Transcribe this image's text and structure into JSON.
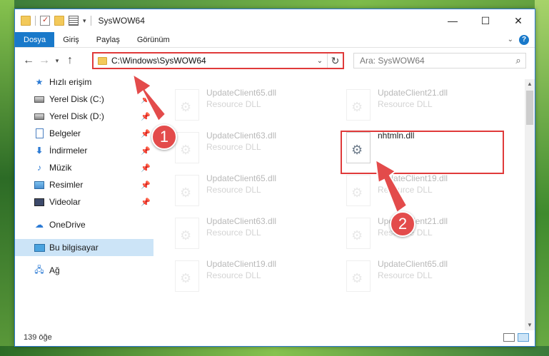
{
  "window": {
    "title": "SysWOW64"
  },
  "ribbon": {
    "tabs": [
      {
        "label": "Dosya",
        "active": true
      },
      {
        "label": "Giriş"
      },
      {
        "label": "Paylaş"
      },
      {
        "label": "Görünüm"
      }
    ]
  },
  "address": {
    "path": "C:\\Windows\\SysWOW64"
  },
  "search": {
    "placeholder": "Ara: SysWOW64"
  },
  "sidebar": {
    "items": [
      {
        "label": "Hızlı erişim",
        "icon": "star-icon"
      },
      {
        "label": "Yerel Disk (C:)",
        "icon": "disk-icon",
        "pinned": true
      },
      {
        "label": "Yerel Disk (D:)",
        "icon": "disk-icon",
        "pinned": true
      },
      {
        "label": "Belgeler",
        "icon": "documents-icon",
        "pinned": true
      },
      {
        "label": "İndirmeler",
        "icon": "downloads-icon",
        "pinned": true
      },
      {
        "label": "Müzik",
        "icon": "music-icon",
        "pinned": true
      },
      {
        "label": "Resimler",
        "icon": "pictures-icon",
        "pinned": true
      },
      {
        "label": "Videolar",
        "icon": "videos-icon",
        "pinned": true
      },
      {
        "label": "OneDrive",
        "icon": "onedrive-icon"
      },
      {
        "label": "Bu bilgisayar",
        "icon": "this-pc-icon",
        "selected": true
      },
      {
        "label": "Ağ",
        "icon": "network-icon"
      }
    ]
  },
  "files": [
    {
      "name": "UpdateClient65.dll",
      "type": "Resource DLL"
    },
    {
      "name": "UpdateClient21.dll",
      "type": "Resource DLL"
    },
    {
      "name": "UpdateClient63.dll",
      "type": "Resource DLL"
    },
    {
      "name": "nhtmln.dll",
      "type": ""
    },
    {
      "name": "UpdateClient65.dll",
      "type": "Resource DLL"
    },
    {
      "name": "UpdateClient19.dll",
      "type": "Resource DLL"
    },
    {
      "name": "UpdateClient63.dll",
      "type": "Resource DLL"
    },
    {
      "name": "UpdateClient21.dll",
      "type": "Resource DLL"
    },
    {
      "name": "UpdateClient19.dll",
      "type": "Resource DLL"
    },
    {
      "name": "UpdateClient65.dll",
      "type": "Resource DLL"
    }
  ],
  "status": {
    "count": "139 öğe"
  },
  "annotations": {
    "step1": "1",
    "step2": "2"
  },
  "colors": {
    "accent": "#1979ca",
    "highlight": "#e03a3a",
    "selected": "#cce4f7"
  }
}
